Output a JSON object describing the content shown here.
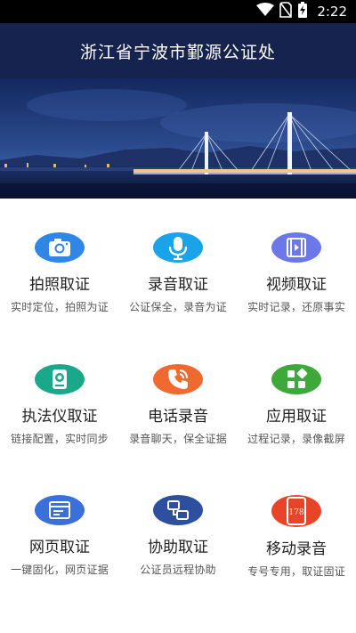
{
  "status_bar": {
    "time": "2:22",
    "icons": [
      "wifi-icon",
      "no-sim-icon",
      "battery-charging-icon"
    ]
  },
  "header": {
    "title": "浙江省宁波市鄞源公证处"
  },
  "banner": {
    "image": "night-bridge-photo"
  },
  "features": [
    {
      "title": "拍照取证",
      "subtitle": "实时定位，拍照为证",
      "icon": "camera-icon",
      "color": "#2f86e6"
    },
    {
      "title": "录音取证",
      "subtitle": "公证保全，录音为证",
      "icon": "microphone-icon",
      "color": "#1aa3e8"
    },
    {
      "title": "视频取证",
      "subtitle": "实时记录，还原事实",
      "icon": "video-film-icon",
      "color": "#6d78e8"
    },
    {
      "title": "执法仪取证",
      "subtitle": "链接配置，实时同步",
      "icon": "body-camera-icon",
      "color": "#19a98a"
    },
    {
      "title": "电话录音",
      "subtitle": "录音聊天，保全证据",
      "icon": "phone-call-icon",
      "color": "#f06a2f"
    },
    {
      "title": "应用取证",
      "subtitle": "过程记录，录像截屏",
      "icon": "app-grid-icon",
      "color": "#3fa83a"
    },
    {
      "title": "网页取证",
      "subtitle": "一键固化，网页证据",
      "icon": "browser-window-icon",
      "color": "#3b6fdc"
    },
    {
      "title": "协助取证",
      "subtitle": "公证员远程协助",
      "icon": "collaborate-icon",
      "color": "#2e4e9e"
    },
    {
      "title": "移动录音",
      "subtitle": "专号专用，取证固证",
      "icon": "mobile-178-icon",
      "color": "#e8442a",
      "icon_text": "178"
    }
  ]
}
